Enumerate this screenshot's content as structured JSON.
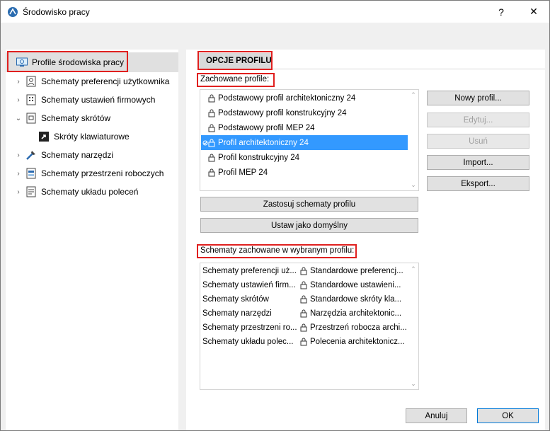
{
  "window": {
    "title": "Środowisko pracy",
    "help_label": "?",
    "close_label": "✕"
  },
  "sidebar": {
    "root": "Profile środowiska pracy",
    "items": [
      {
        "label": "Schematy preferencji użytkownika",
        "chevron": "›",
        "icon": "user-prefs-icon"
      },
      {
        "label": "Schematy ustawień firmowych",
        "chevron": "›",
        "icon": "company-settings-icon"
      },
      {
        "label": "Schematy skrótów",
        "chevron": "⌄",
        "icon": "shortcuts-icon"
      },
      {
        "label": "Skróty klawiaturowe",
        "chevron": "",
        "icon": "keyboard-shortcut-icon"
      },
      {
        "label": "Schematy narzędzi",
        "chevron": "›",
        "icon": "tools-icon"
      },
      {
        "label": "Schematy przestrzeni roboczych",
        "chevron": "›",
        "icon": "workspace-icon"
      },
      {
        "label": "Schematy układu poleceń",
        "chevron": "›",
        "icon": "command-layout-icon"
      }
    ]
  },
  "main": {
    "section_title": "OPCJE PROFILU",
    "saved_profiles_label": "Zachowane profile:",
    "profiles": [
      "Podstawowy profil architektoniczny 24",
      "Podstawowy profil konstrukcyjny 24",
      "Podstawowy profil MEP 24",
      "Profil architektoniczny 24",
      "Profil konstrukcyjny 24",
      "Profil MEP 24"
    ],
    "selected_profile_index": 3,
    "buttons": {
      "new_profile": "Nowy profil...",
      "edit": "Edytuj...",
      "delete": "Usuń",
      "import": "Import...",
      "export": "Eksport...",
      "apply": "Zastosuj schematy profilu",
      "set_default": "Ustaw jako domyślny"
    },
    "schemes_label": "Schematy zachowane w wybranym profilu:",
    "schemes": [
      {
        "name": "Schematy preferencji uż...",
        "value": "Standardowe preferencj..."
      },
      {
        "name": "Schematy ustawień firm...",
        "value": "Standardowe ustawieni..."
      },
      {
        "name": "Schematy skrótów",
        "value": "Standardowe skróty kla..."
      },
      {
        "name": "Schematy narzędzi",
        "value": "Narzędzia architektonic..."
      },
      {
        "name": "Schematy przestrzeni ro...",
        "value": "Przestrzeń robocza archi..."
      },
      {
        "name": "Schematy układu polec...",
        "value": "Polecenia architektonicz..."
      }
    ]
  },
  "footer": {
    "cancel": "Anuluj",
    "ok": "OK"
  },
  "colors": {
    "highlight": "#e0201f",
    "selection": "#3399ff",
    "accent": "#0078d7"
  }
}
